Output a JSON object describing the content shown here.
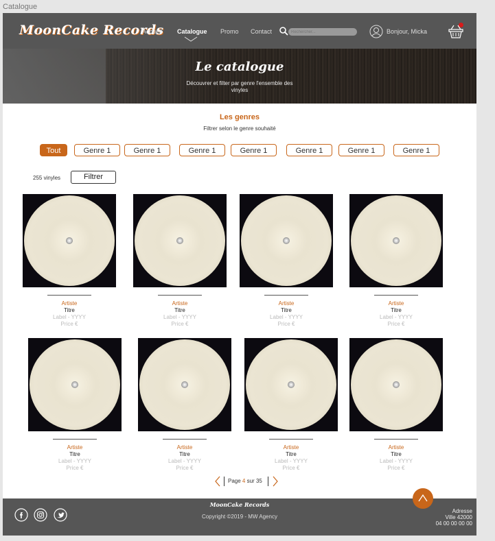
{
  "frame_label": "Catalogue",
  "header": {
    "logo": "MoonCake Records",
    "nav": [
      {
        "label": "Accueil"
      },
      {
        "label": "Catalogue"
      },
      {
        "label": "Promo"
      },
      {
        "label": "Contact"
      }
    ],
    "search_placeholder": "Rechercher...",
    "greeting": "Bonjour, Micka"
  },
  "hero": {
    "title": "Le catalogue",
    "subtitle": "Découvrer et filter par genre l'ensemble des vinyles"
  },
  "genres": {
    "title": "Les genres",
    "subtitle": "Filtrer selon le genre souhaité",
    "chips": [
      "Tout",
      "Genre 1",
      "Genre 1",
      "Genre 1",
      "Genre 1",
      "Genre 1",
      "Genre 1",
      "Genre 1"
    ]
  },
  "results": {
    "count": "255 vinyles",
    "filter_label": "Filtrer"
  },
  "products": [
    {
      "artist": "Artiste",
      "title": "Titre",
      "label": "Label - YYYY",
      "price": "Price €"
    },
    {
      "artist": "Artiste",
      "title": "Titre",
      "label": "Label - YYYY",
      "price": "Price €"
    },
    {
      "artist": "Artiste",
      "title": "Titre",
      "label": "Label - YYYY",
      "price": "Price €"
    },
    {
      "artist": "Artiste",
      "title": "Titre",
      "label": "Label - YYYY",
      "price": "Price €"
    },
    {
      "artist": "Artiste",
      "title": "Titre",
      "label": "Label - YYYY",
      "price": "Price €"
    },
    {
      "artist": "Artiste",
      "title": "Titre",
      "label": "Label - YYYY",
      "price": "Price €"
    },
    {
      "artist": "Artiste",
      "title": "Titre",
      "label": "Label - YYYY",
      "price": "Price €"
    },
    {
      "artist": "Artiste",
      "title": "Titre",
      "label": "Label - YYYY",
      "price": "Price €"
    }
  ],
  "pagination": {
    "prefix": "Page",
    "current": "4",
    "middle": "sur",
    "total": "35"
  },
  "footer": {
    "logo": "MoonCake Records",
    "copyright": "Copyright ©2019 - MW Agency",
    "address": [
      "Adresse",
      "Ville 42000",
      "04 00 00 00 00"
    ]
  },
  "colors": {
    "accent": "#c8661a",
    "header_bg": "#565656",
    "badge": "#d81a1a"
  }
}
